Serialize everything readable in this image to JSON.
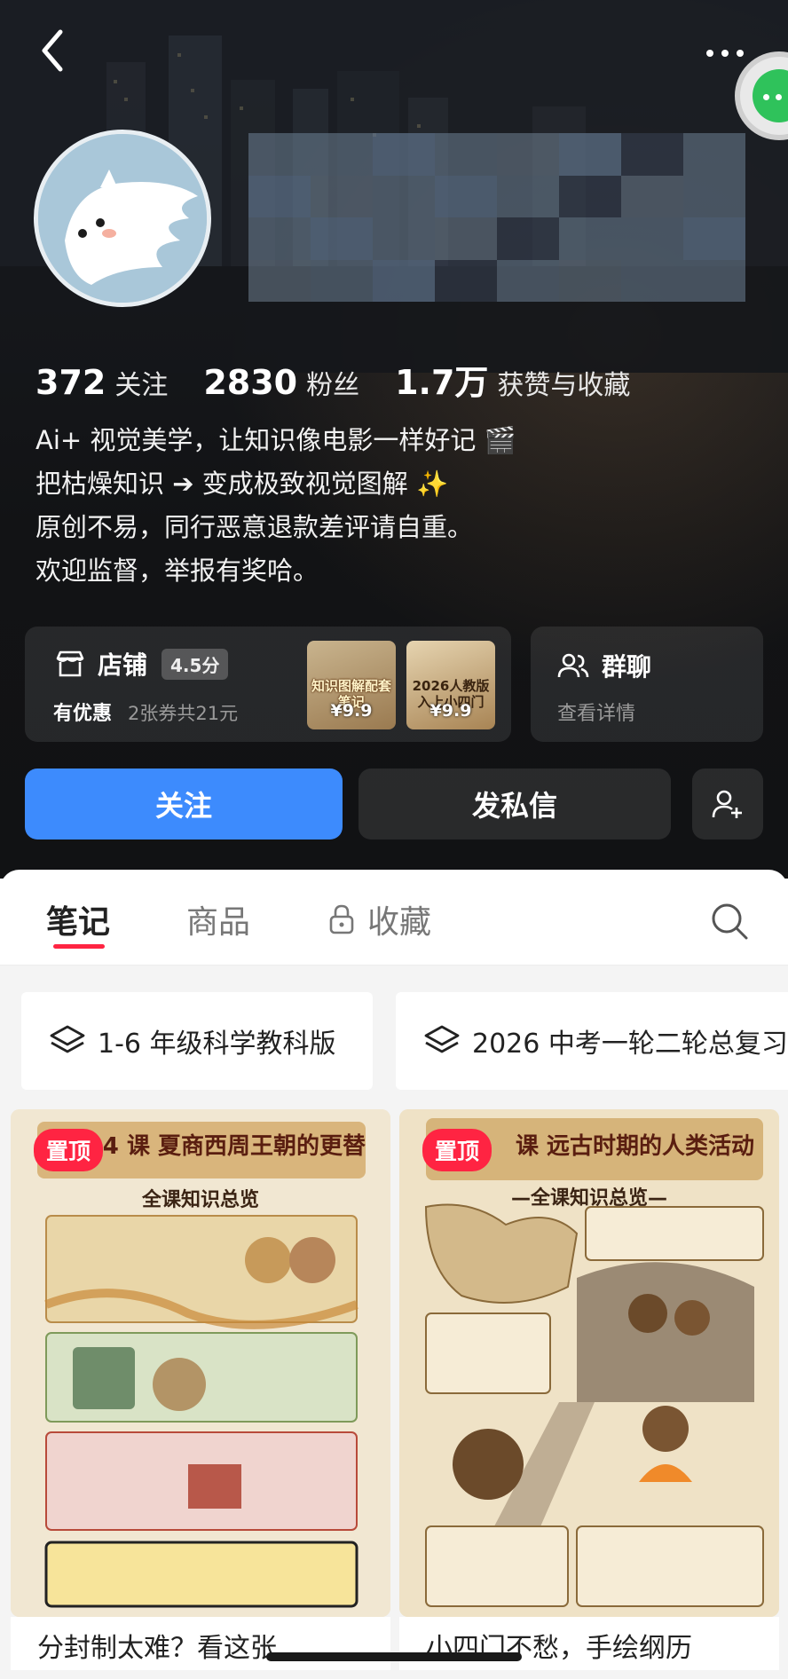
{
  "colors": {
    "accent_red": "#ff2442",
    "follow_blue": "#3d8bfd",
    "dark_bg": "#121315",
    "wechat_green": "#2fc25b"
  },
  "nav": {
    "back_icon": "chevron-left-icon",
    "more_icon": "more-dots-icon"
  },
  "profile": {
    "avatar_icon": "pomeranian-dog-avatar",
    "stats": [
      {
        "num": "372",
        "label": "关注"
      },
      {
        "num": "2830",
        "label": "粉丝"
      },
      {
        "num": "1.7万",
        "label": "获赞与收藏"
      }
    ],
    "bio": [
      "Ai+ 视觉美学，让知识像电影一样好记 🎬",
      "把枯燥知识 ➔ 变成极致视觉图解 ✨",
      "原创不易，同行恶意退款差评请自重。",
      "欢迎监督，举报有奖哈。"
    ]
  },
  "shop": {
    "title": "店铺",
    "score": "4.5分",
    "deal": "有优惠",
    "deal_detail": "2张券共21元",
    "products": [
      {
        "label": "知识图解配套笔记",
        "price": "¥9.9"
      },
      {
        "label": "2026人教版 入上小四门",
        "price": "¥9.9"
      }
    ]
  },
  "group": {
    "title": "群聊",
    "sub": "查看详情"
  },
  "actions": {
    "follow": "关注",
    "message": "发私信"
  },
  "tabs": [
    {
      "label": "笔记"
    },
    {
      "label": "商品"
    },
    {
      "label": "收藏"
    }
  ],
  "collections": [
    {
      "label": "1-6 年级科学教科版"
    },
    {
      "label": "2026 中考一轮二轮总复习"
    }
  ],
  "notes": [
    {
      "pin": "置顶",
      "title": "4 课 夏商西周王朝的更替",
      "subtitle": "全课知识总览",
      "caption": "分封制太难？看这张"
    },
    {
      "pin": "置顶",
      "title": "课 远古时期的人类活动",
      "subtitle": "—全课知识总览—",
      "caption": "小四门不愁，手绘纲历"
    }
  ]
}
